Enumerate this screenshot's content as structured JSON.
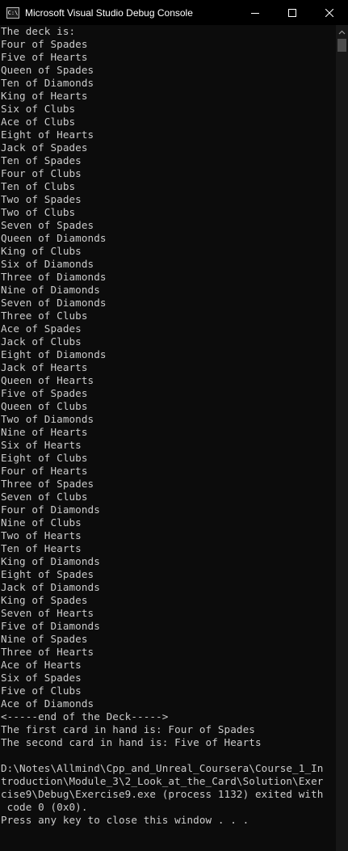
{
  "window": {
    "title": "Microsoft Visual Studio Debug Console",
    "icon_label": "C:\\",
    "controls": [
      "minimize-icon",
      "maximize-icon",
      "close-icon"
    ]
  },
  "colors": {
    "background": "#0c0c0c",
    "text": "#cccccc",
    "titlebar": "#000000",
    "scroll_thumb": "#4d4d4d"
  },
  "console": {
    "lines": [
      "The deck is:",
      "Four of Spades",
      "Five of Hearts",
      "Queen of Spades",
      "Ten of Diamonds",
      "King of Hearts",
      "Six of Clubs",
      "Ace of Clubs",
      "Eight of Hearts",
      "Jack of Spades",
      "Ten of Spades",
      "Four of Clubs",
      "Ten of Clubs",
      "Two of Spades",
      "Two of Clubs",
      "Seven of Spades",
      "Queen of Diamonds",
      "King of Clubs",
      "Six of Diamonds",
      "Three of Diamonds",
      "Nine of Diamonds",
      "Seven of Diamonds",
      "Three of Clubs",
      "Ace of Spades",
      "Jack of Clubs",
      "Eight of Diamonds",
      "Jack of Hearts",
      "Queen of Hearts",
      "Five of Spades",
      "Queen of Clubs",
      "Two of Diamonds",
      "Nine of Hearts",
      "Six of Hearts",
      "Eight of Clubs",
      "Four of Hearts",
      "Three of Spades",
      "Seven of Clubs",
      "Four of Diamonds",
      "Nine of Clubs",
      "Two of Hearts",
      "Ten of Hearts",
      "King of Diamonds",
      "Eight of Spades",
      "Jack of Diamonds",
      "King of Spades",
      "Seven of Hearts",
      "Five of Diamonds",
      "Nine of Spades",
      "Three of Hearts",
      "Ace of Hearts",
      "Six of Spades",
      "Five of Clubs",
      "Ace of Diamonds",
      "<-----end of the Deck----->",
      "The first card in hand is: Four of Spades",
      "The second card in hand is: Five of Hearts",
      "",
      "D:\\Notes\\Allmind\\Cpp_and_Unreal_Coursera\\Course_1_In",
      "troduction\\Module_3\\2_Look_at_the_Card\\Solution\\Exer",
      "cise9\\Debug\\Exercise9.exe (process 1132) exited with",
      " code 0 (0x0).",
      "Press any key to close this window . . ."
    ]
  }
}
